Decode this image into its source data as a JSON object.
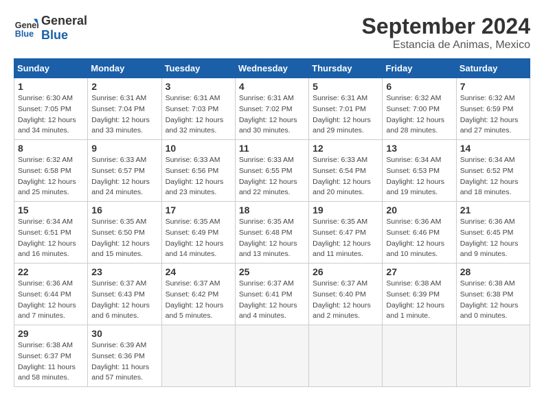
{
  "header": {
    "logo_line1": "General",
    "logo_line2": "Blue",
    "title": "September 2024",
    "subtitle": "Estancia de Animas, Mexico"
  },
  "weekdays": [
    "Sunday",
    "Monday",
    "Tuesday",
    "Wednesday",
    "Thursday",
    "Friday",
    "Saturday"
  ],
  "weeks": [
    [
      {
        "day": "1",
        "sunrise": "6:30 AM",
        "sunset": "7:05 PM",
        "daylight": "12 hours and 34 minutes."
      },
      {
        "day": "2",
        "sunrise": "6:31 AM",
        "sunset": "7:04 PM",
        "daylight": "12 hours and 33 minutes."
      },
      {
        "day": "3",
        "sunrise": "6:31 AM",
        "sunset": "7:03 PM",
        "daylight": "12 hours and 32 minutes."
      },
      {
        "day": "4",
        "sunrise": "6:31 AM",
        "sunset": "7:02 PM",
        "daylight": "12 hours and 30 minutes."
      },
      {
        "day": "5",
        "sunrise": "6:31 AM",
        "sunset": "7:01 PM",
        "daylight": "12 hours and 29 minutes."
      },
      {
        "day": "6",
        "sunrise": "6:32 AM",
        "sunset": "7:00 PM",
        "daylight": "12 hours and 28 minutes."
      },
      {
        "day": "7",
        "sunrise": "6:32 AM",
        "sunset": "6:59 PM",
        "daylight": "12 hours and 27 minutes."
      }
    ],
    [
      {
        "day": "8",
        "sunrise": "6:32 AM",
        "sunset": "6:58 PM",
        "daylight": "12 hours and 25 minutes."
      },
      {
        "day": "9",
        "sunrise": "6:33 AM",
        "sunset": "6:57 PM",
        "daylight": "12 hours and 24 minutes."
      },
      {
        "day": "10",
        "sunrise": "6:33 AM",
        "sunset": "6:56 PM",
        "daylight": "12 hours and 23 minutes."
      },
      {
        "day": "11",
        "sunrise": "6:33 AM",
        "sunset": "6:55 PM",
        "daylight": "12 hours and 22 minutes."
      },
      {
        "day": "12",
        "sunrise": "6:33 AM",
        "sunset": "6:54 PM",
        "daylight": "12 hours and 20 minutes."
      },
      {
        "day": "13",
        "sunrise": "6:34 AM",
        "sunset": "6:53 PM",
        "daylight": "12 hours and 19 minutes."
      },
      {
        "day": "14",
        "sunrise": "6:34 AM",
        "sunset": "6:52 PM",
        "daylight": "12 hours and 18 minutes."
      }
    ],
    [
      {
        "day": "15",
        "sunrise": "6:34 AM",
        "sunset": "6:51 PM",
        "daylight": "12 hours and 16 minutes."
      },
      {
        "day": "16",
        "sunrise": "6:35 AM",
        "sunset": "6:50 PM",
        "daylight": "12 hours and 15 minutes."
      },
      {
        "day": "17",
        "sunrise": "6:35 AM",
        "sunset": "6:49 PM",
        "daylight": "12 hours and 14 minutes."
      },
      {
        "day": "18",
        "sunrise": "6:35 AM",
        "sunset": "6:48 PM",
        "daylight": "12 hours and 13 minutes."
      },
      {
        "day": "19",
        "sunrise": "6:35 AM",
        "sunset": "6:47 PM",
        "daylight": "12 hours and 11 minutes."
      },
      {
        "day": "20",
        "sunrise": "6:36 AM",
        "sunset": "6:46 PM",
        "daylight": "12 hours and 10 minutes."
      },
      {
        "day": "21",
        "sunrise": "6:36 AM",
        "sunset": "6:45 PM",
        "daylight": "12 hours and 9 minutes."
      }
    ],
    [
      {
        "day": "22",
        "sunrise": "6:36 AM",
        "sunset": "6:44 PM",
        "daylight": "12 hours and 7 minutes."
      },
      {
        "day": "23",
        "sunrise": "6:37 AM",
        "sunset": "6:43 PM",
        "daylight": "12 hours and 6 minutes."
      },
      {
        "day": "24",
        "sunrise": "6:37 AM",
        "sunset": "6:42 PM",
        "daylight": "12 hours and 5 minutes."
      },
      {
        "day": "25",
        "sunrise": "6:37 AM",
        "sunset": "6:41 PM",
        "daylight": "12 hours and 4 minutes."
      },
      {
        "day": "26",
        "sunrise": "6:37 AM",
        "sunset": "6:40 PM",
        "daylight": "12 hours and 2 minutes."
      },
      {
        "day": "27",
        "sunrise": "6:38 AM",
        "sunset": "6:39 PM",
        "daylight": "12 hours and 1 minute."
      },
      {
        "day": "28",
        "sunrise": "6:38 AM",
        "sunset": "6:38 PM",
        "daylight": "12 hours and 0 minutes."
      }
    ],
    [
      {
        "day": "29",
        "sunrise": "6:38 AM",
        "sunset": "6:37 PM",
        "daylight": "11 hours and 58 minutes."
      },
      {
        "day": "30",
        "sunrise": "6:39 AM",
        "sunset": "6:36 PM",
        "daylight": "11 hours and 57 minutes."
      },
      null,
      null,
      null,
      null,
      null
    ]
  ]
}
